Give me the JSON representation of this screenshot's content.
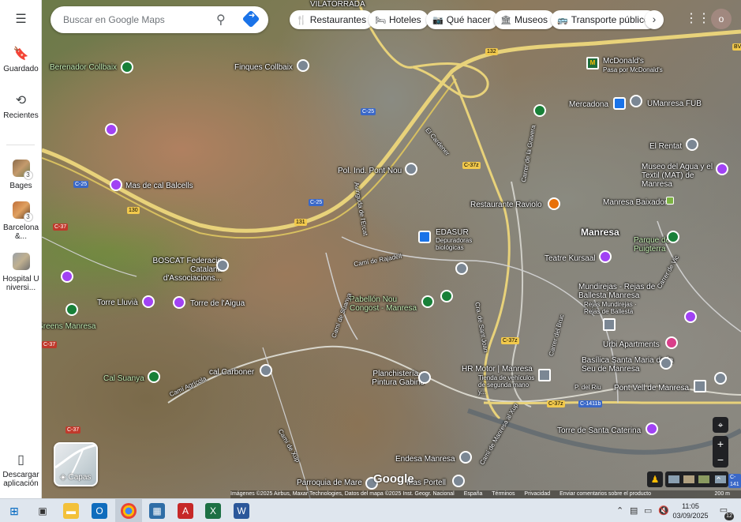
{
  "sidebar": {
    "menu_icon": "hamburger-icon",
    "items": [
      {
        "label": "Guardado",
        "icon": "bookmark-icon"
      },
      {
        "label": "Recientes",
        "icon": "history-icon"
      }
    ],
    "recent_places": [
      {
        "label": "Bages",
        "badge": "3"
      },
      {
        "label": "Barcelona &...",
        "badge": "3"
      },
      {
        "label": "Hospital Universi..."
      }
    ],
    "download": {
      "label": "Descargar aplicación",
      "icon": "phone-icon"
    }
  },
  "search": {
    "placeholder": "Buscar en Google Maps",
    "icon": "search-icon",
    "directions_icon": "directions-icon"
  },
  "chips": [
    {
      "label": "Restaurantes",
      "icon": "fork-knife-icon"
    },
    {
      "label": "Hoteles",
      "icon": "bed-icon"
    },
    {
      "label": "Qué hacer",
      "icon": "camera-icon"
    },
    {
      "label": "Museos",
      "icon": "museum-icon"
    },
    {
      "label": "Transporte público",
      "icon": "bus-icon"
    }
  ],
  "account": {
    "initial": "o"
  },
  "map": {
    "labels": {
      "vilatorrada": "VILATORRADA",
      "finques": "Finques Collbaix",
      "berenador": "Berenador Collbaix",
      "mcdonalds": "McDonald's",
      "mcdonalds_sub": "Pasa por McDonald's",
      "mercadona": "Mercadona",
      "umanresa": "UManresa FUB",
      "rentat": "El Rentat",
      "museu": "Museo del Agua y el Textil (MAT) de Manresa",
      "cal_balcells": "Mas de cal Balcells",
      "pol_ind": "Pol. Ind. Pont Nou",
      "edasur": "EDASUR",
      "edasur_sub": "Depuradoras biológicas",
      "raviolo": "Restaurante Raviolo",
      "baixador": "Manresa Baixador",
      "manresa": "Manresa",
      "puigterra": "Parque de Puigterra",
      "kursaal": "Teatre Kursaal",
      "boscat": "BOSCAT Federacio Catalana d'Associacions...",
      "mundirejas": "Mundirejas - Rejas de Ballesta Manresa",
      "mundirejas_sub": "Rejas Mundirejas · Rejas de Ballesta",
      "torre_lluvia": "Torre Lluvià",
      "torre_aigua": "Torre de l'Aigua",
      "pabellon": "Pabellón Nou Congost - Manresa",
      "urbi": "Urbi Apartments",
      "basilica": "Basílica Santa Maria de la Seu de Manresa",
      "hr_motor": "HR Motor | Manresa",
      "hr_motor_sub": "Tienda de vehículos de segunda mano y...",
      "cal_carboner": "cal Carboner",
      "planchisteria": "Planchistería y Pintura Gabino",
      "pont_vell": "Pont Vell de Manresa",
      "cal_suanya": "Cal Suanya",
      "torre_caterina": "Torre de Santa Caterina",
      "endesa": "Endesa Manresa",
      "parroquia": "Parroquia de Mare",
      "mas_portell": "Mas Portell",
      "greens": "Greens Manresa",
      "cami_agricola": "Camí Agrícola",
      "cami_suanya": "Camí de Suanya",
      "cami_xup": "Camí de Xup",
      "cami_rajadell": "Camí de Rajadell",
      "cra_sant_joan": "Cra. de Sant Joan",
      "carrer_bruc": "Carrer del Bruc",
      "passeig_riu": "P. del Riu",
      "cami_xup2": "Camí de Manresa al Xup",
      "carrer_vic": "Carrer de Vic",
      "carrer_gravera": "Carrer de la Gravera",
      "el_cardener": "El Cardener",
      "avinguda_ercat": "Avinguda de l'Ercat"
    },
    "shields": {
      "c25a": "C-25",
      "c25b": "C-25",
      "c25c": "C-25",
      "c37a": "C-37",
      "c37b": "C-37",
      "c37c": "C-37",
      "c37z_a": "C-37z",
      "c37z_b": "C-37z",
      "c37z_c": "C-37z",
      "r130": "130",
      "r131": "131",
      "r132": "132",
      "c1411b": "C-1411b",
      "bv": "BV-",
      "c141": "C-141"
    },
    "layers_label": "Capas",
    "google_logo": "Google",
    "attribution": {
      "imagery": "Imágenes ©2025 Airbus, Maxar Technologies, Datos del mapa ©2025 Inst. Geogr. Nacional",
      "country": "España",
      "terms": "Términos",
      "privacy": "Privacidad",
      "feedback": "Enviar comentarios sobre el producto",
      "scale": "200 m"
    }
  },
  "taskbar": {
    "time": "11:05",
    "date": "03/09/2025",
    "notifications": "12"
  }
}
